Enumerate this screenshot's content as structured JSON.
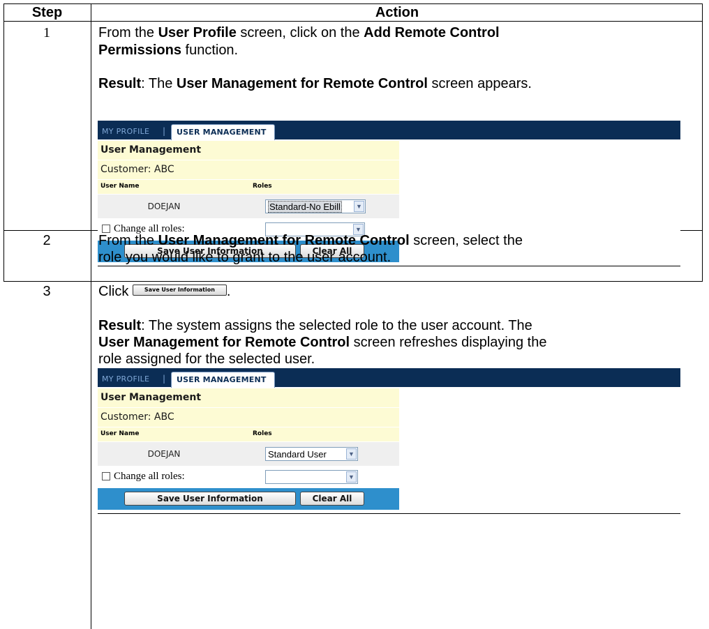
{
  "header": {
    "step": "Step",
    "action": "Action"
  },
  "steps": [
    {
      "number": "1",
      "line1_a": "From the ",
      "line1_b": "User Profile",
      "line1_c": " screen, click on the ",
      "line1_d": "Add Remote Control",
      "line2_a": "Permissions",
      "line2_b": " function.",
      "result_label": "Result",
      "result_a": ":  The ",
      "result_b": "User Management for Remote Control",
      "result_c": " screen appears."
    },
    {
      "number": "2",
      "line1_a": "From the ",
      "line1_b": "User Management for Remote Control",
      "line1_c": " screen, select the",
      "line2": "role you would like to grant to the user account."
    },
    {
      "number": "3",
      "click": "Click ",
      "period": ".",
      "result_label": "Result",
      "result_a": ":  The system assigns the selected role to the user account.  The",
      "result_b": "User Management for Remote Control",
      "result_c": " screen refreshes displaying the",
      "result_d": "role assigned for the selected user."
    }
  ],
  "screenshots": [
    {
      "nav_my_profile": "MY PROFILE",
      "nav_sep": "|",
      "nav_tab": "USER MANAGEMENT",
      "title": "User Management",
      "customer": "Customer: ABC",
      "col_user": "User Name",
      "col_roles": "Roles",
      "user": "DOEJAN",
      "role": "Standard-No Ebill",
      "change_all": "Change all roles:",
      "save_btn": "Save User Information",
      "clear_btn": "Clear All"
    },
    {
      "nav_my_profile": "MY PROFILE",
      "nav_sep": "|",
      "nav_tab": "USER MANAGEMENT",
      "title": "User Management",
      "customer": "Customer: ABC",
      "col_user": "User Name",
      "col_roles": "Roles",
      "user": "DOEJAN",
      "role": "Standard User",
      "change_all": "Change all roles:",
      "save_btn": "Save User Information",
      "clear_btn": "Clear All"
    }
  ],
  "inline_button": "Save User Information",
  "icons": {
    "dropdown": "chevron-down-icon",
    "checkbox": "checkbox-icon"
  }
}
